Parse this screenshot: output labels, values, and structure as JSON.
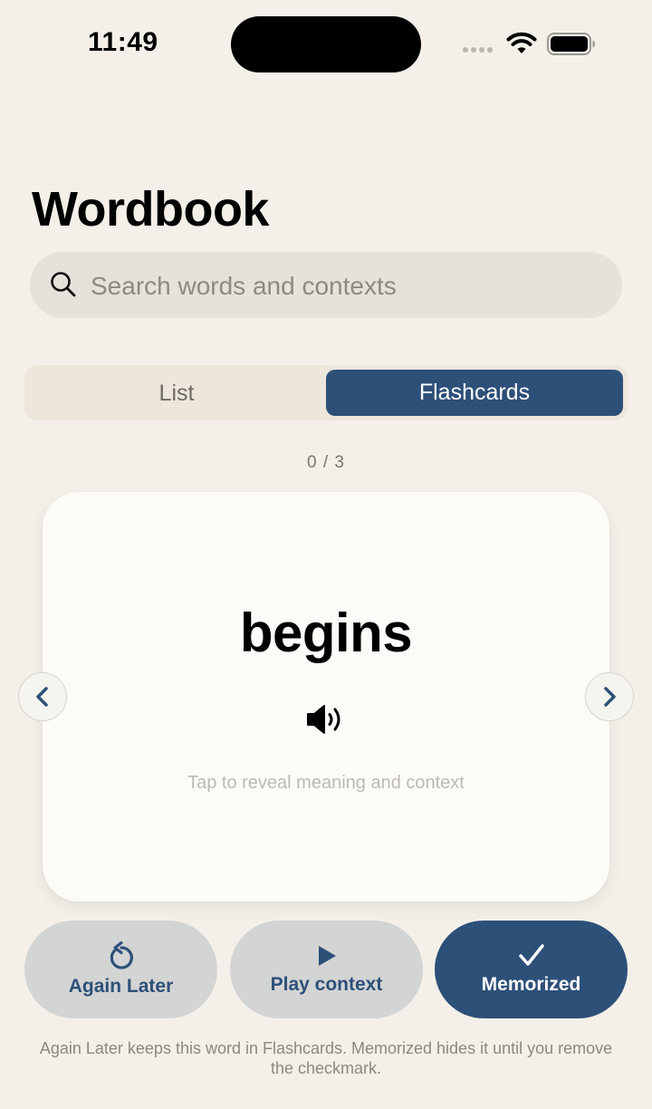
{
  "status_bar": {
    "time": "11:49"
  },
  "header": {
    "title": "Wordbook"
  },
  "search": {
    "placeholder": "Search words and contexts",
    "value": ""
  },
  "view_toggle": {
    "options": [
      "List",
      "Flashcards"
    ],
    "selected": "Flashcards"
  },
  "progress": {
    "label": "0 / 3",
    "current": 0,
    "total": 3
  },
  "card": {
    "word": "begins",
    "hint": "Tap to reveal meaning and context"
  },
  "actions": {
    "again_later": "Again Later",
    "play_context": "Play context",
    "memorized": "Memorized"
  },
  "footnote": "Again Later keeps this word in Flashcards. Memorized hides it until you remove the checkmark.",
  "colors": {
    "background": "#f4f0e9",
    "accent": "#2d5079",
    "card": "#fdfbf7",
    "secondary_button": "#d3d4d4"
  }
}
